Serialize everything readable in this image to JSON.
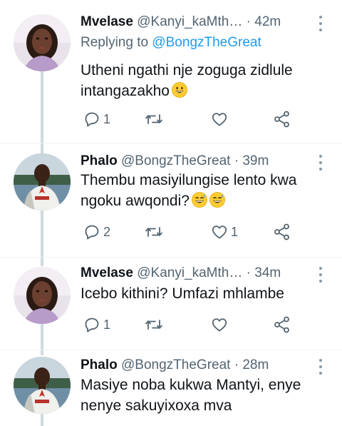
{
  "tweets": [
    {
      "name": "Mvelase",
      "handle": "@Kanyi_kaMth…",
      "dot": " · ",
      "time": "42m",
      "replying_prefix": "Replying to ",
      "replying_to": "@BongzTheGreat",
      "text_line1": "Utheni ngathi nje zoguga zidlule",
      "text_line2": "intangazakho",
      "emoji_icon": "grinning-face-emoji",
      "reply_count": "1",
      "retweet_count": "",
      "like_count": ""
    },
    {
      "name": "Phalo",
      "handle": "@BongzTheGreat",
      "dot": " · ",
      "time": "39m",
      "text_line1": "Thembu masiyilungise lento kwa",
      "text_line2": "ngoku awqondi?",
      "emoji_icon": "grinning-sweat-emoji",
      "reply_count": "2",
      "retweet_count": "",
      "like_count": "1"
    },
    {
      "name": "Mvelase",
      "handle": "@Kanyi_kaMth…",
      "dot": " · ",
      "time": "34m",
      "text_line1": "Icebo kithini? Umfazi mhlambe",
      "reply_count": "1",
      "retweet_count": "",
      "like_count": ""
    },
    {
      "name": "Phalo",
      "handle": "@BongzTheGreat",
      "dot": " · ",
      "time": "28m",
      "text_line1": "Masiye noba kukwa Mantyi, enye",
      "text_line2": "nenye sakuyixoxa mva"
    }
  ],
  "colors": {
    "text": "#0f1419",
    "secondary": "#536471",
    "link": "#1d9bf0",
    "thread_line": "#cfd9de"
  }
}
